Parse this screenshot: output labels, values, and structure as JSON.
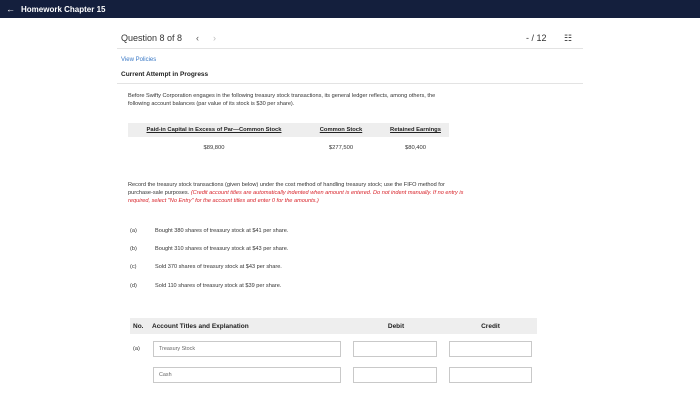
{
  "header": {
    "back_icon": "arrow-left-icon",
    "title": "Homework Chapter 15"
  },
  "question_nav": {
    "label": "Question 8 of 8",
    "prev": "‹",
    "next": "›",
    "score": "- / 12",
    "list_icon": "list-icon"
  },
  "policies_link": "View Policies",
  "attempt_label": "Current Attempt in Progress",
  "intro": {
    "line1": "Before Swifty Corporation engages in the following treasury stock transactions, its general ledger reflects, among others, the",
    "line2": "following account balances (par value of its stock is $30 per share)."
  },
  "balances": {
    "headers": [
      "Paid-in Capital in Excess of Par—Common Stock",
      "Common Stock",
      "Retained Earnings"
    ],
    "values": [
      "$89,800",
      "$277,500",
      "$80,400"
    ]
  },
  "instructions": {
    "line1": "Record the treasury stock transactions (given below) under the cost method of handling treasury stock; use the FIFO method for",
    "line2_plain": "purchase-sale purposes. ",
    "line2_red": "(Credit account titles are automatically indented when amount is entered. Do not indent manually. If no entry is",
    "line3_red": "required, select \"No Entry\" for the account titles and enter 0 for the amounts.)"
  },
  "transactions": [
    {
      "label": "(a)",
      "text": "Bought 380 shares of treasury stock at $41 per share."
    },
    {
      "label": "(b)",
      "text": "Bought 310 shares of treasury stock at $43 per share."
    },
    {
      "label": "(c)",
      "text": "Sold 370 shares of treasury stock at $43 per share."
    },
    {
      "label": "(d)",
      "text": "Sold 110 shares of treasury stock at $39 per share."
    }
  ],
  "journal": {
    "headers": {
      "no": "No.",
      "account": "Account Titles and Explanation",
      "debit": "Debit",
      "credit": "Credit"
    },
    "row_label": "(a)",
    "account_1": "Treasury Stock",
    "account_2": "Cash",
    "debit_1": "",
    "credit_1": "",
    "debit_2": "",
    "credit_2": ""
  },
  "colors": {
    "header_bg": "#141f3d",
    "link": "#3a79c6",
    "required_note": "#d8232a",
    "table_header_bg": "#eeeeee"
  }
}
